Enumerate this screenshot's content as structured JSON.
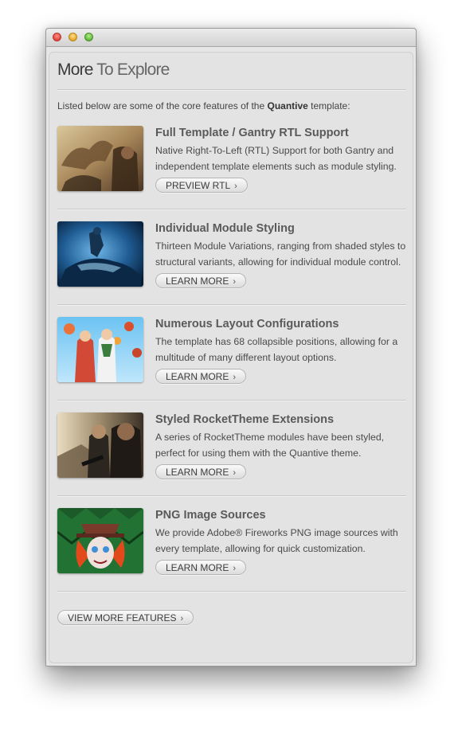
{
  "panel": {
    "title_part1": "More",
    "title_part2": " To Explore",
    "intro_before": "Listed below are some of the core features of the ",
    "intro_brand": "Quantive",
    "intro_after": " template:"
  },
  "features": [
    {
      "title": "Full Template / Gantry RTL Support",
      "description": "Native Right-To-Left (RTL) Support for both Gantry and independent template elements such as module styling.",
      "button": "PREVIEW RTL"
    },
    {
      "title": "Individual Module Styling",
      "description": "Thirteen Module Variations, ranging from shaded styles to structural variants, allowing for individual module control.",
      "button": "LEARN MORE"
    },
    {
      "title": "Numerous Layout Configurations",
      "description": "The template has 68 collapsible positions, allowing for a multitude of many different layout options.",
      "button": "LEARN MORE"
    },
    {
      "title": "Styled RocketTheme Extensions",
      "description": "A series of RocketTheme modules have been styled, perfect for using them with the Quantive theme.",
      "button": "LEARN MORE"
    },
    {
      "title": "PNG Image Sources",
      "description": "We provide Adobe® Fireworks PNG image sources with every template, allowing for quick customization.",
      "button": "LEARN MORE"
    }
  ],
  "footer": {
    "view_more": "VIEW MORE FEATURES"
  },
  "icons": {
    "button_arrow": "chevron-right-icon",
    "window_controls": [
      "close-icon",
      "minimize-icon",
      "zoom-icon"
    ]
  }
}
